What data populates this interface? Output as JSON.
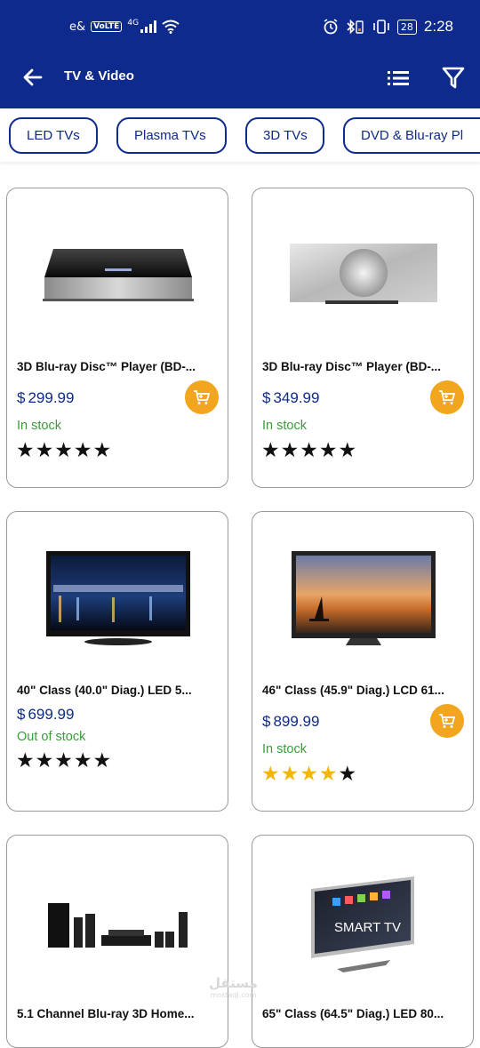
{
  "status_bar": {
    "carrier": "e&",
    "volte": "VoLTE",
    "network": "4G",
    "battery": "28",
    "time": "2:28"
  },
  "app_bar": {
    "title": "TV & Video",
    "back_icon": "arrow-left-icon",
    "list_icon": "list-view-icon",
    "filter_icon": "filter-icon"
  },
  "categories": [
    "LED TVs",
    "Plasma TVs",
    "3D TVs",
    "DVD & Blu-ray Pl"
  ],
  "currency": "$",
  "products": [
    {
      "name": "3D Blu-ray Disc™ Player (BD-...",
      "price": "299.99",
      "stock": "In stock",
      "rating": 5,
      "in_stock": true
    },
    {
      "name": "3D Blu-ray Disc™ Player (BD-...",
      "price": "349.99",
      "stock": "In stock",
      "rating": 5,
      "in_stock": true
    },
    {
      "name": "40\" Class (40.0\" Diag.) LED 5...",
      "price": "699.99",
      "stock": "Out of stock",
      "rating": 5,
      "in_stock": false
    },
    {
      "name": "46\" Class (45.9\" Diag.) LCD 61...",
      "price": "899.99",
      "stock": "In stock",
      "rating": 4.5,
      "in_stock": true
    },
    {
      "name": "5.1 Channel Blu-ray 3D Home...",
      "price": "",
      "stock": "",
      "rating": 0,
      "in_stock": true
    },
    {
      "name": "65\" Class (64.5\" Diag.) LED 80...",
      "price": "",
      "stock": "",
      "rating": 0,
      "in_stock": true
    }
  ],
  "smart_tv_text": "SMART TV",
  "watermark": {
    "arabic": "مستقل",
    "latin": "mostaql.com"
  },
  "colors": {
    "header": "#0d2a8c",
    "accent": "#f2a51e",
    "in_stock": "#3a9c3a",
    "star_gold": "#f2b705"
  }
}
